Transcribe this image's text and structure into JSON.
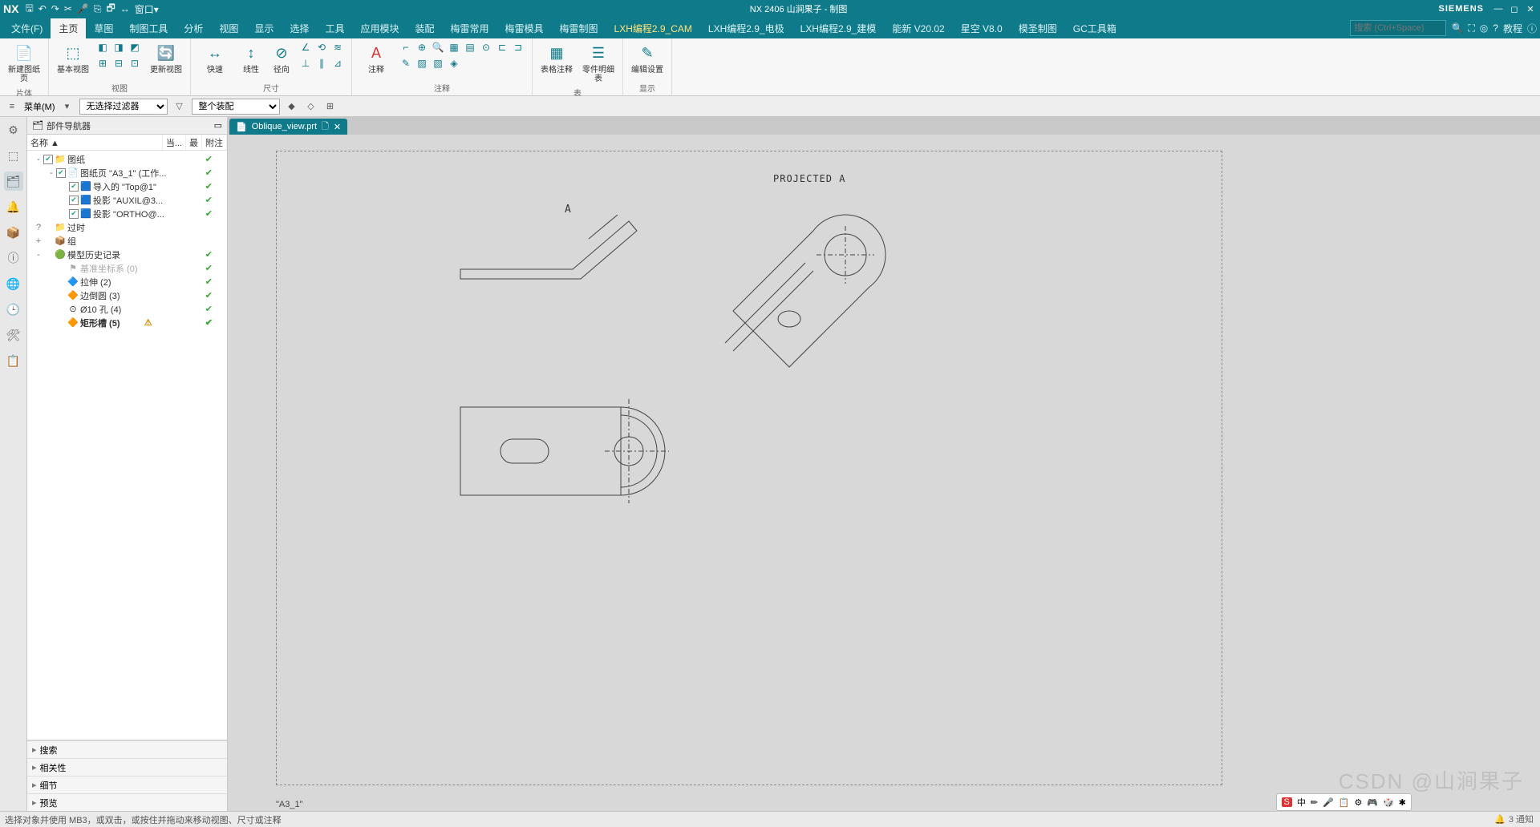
{
  "title": "NX 2406 山涧果子 - 制图",
  "brand": "SIEMENS",
  "qat": [
    "🖫",
    "↶",
    "↷",
    "✂",
    "🎤",
    "⎘",
    "🗗",
    "↔",
    "窗口▾"
  ],
  "menu": [
    {
      "label": "文件(F)",
      "active": false
    },
    {
      "label": "主页",
      "active": true
    },
    {
      "label": "草图",
      "active": false
    },
    {
      "label": "制图工具",
      "active": false
    },
    {
      "label": "分析",
      "active": false
    },
    {
      "label": "视图",
      "active": false
    },
    {
      "label": "显示",
      "active": false
    },
    {
      "label": "选择",
      "active": false
    },
    {
      "label": "工具",
      "active": false
    },
    {
      "label": "应用模块",
      "active": false
    },
    {
      "label": "装配",
      "active": false
    },
    {
      "label": "梅雷常用",
      "active": false
    },
    {
      "label": "梅雷模具",
      "active": false
    },
    {
      "label": "梅雷制图",
      "active": false
    },
    {
      "label": "LXH编程2.9_CAM",
      "active": false,
      "hl": true
    },
    {
      "label": "LXH编程2.9_电极",
      "active": false
    },
    {
      "label": "LXH编程2.9_建模",
      "active": false
    },
    {
      "label": "能新 V20.02",
      "active": false
    },
    {
      "label": "星空 V8.0",
      "active": false
    },
    {
      "label": "模圣制图",
      "active": false
    },
    {
      "label": "GC工具箱",
      "active": false
    }
  ],
  "search_placeholder": "搜索 (Ctrl+Space)",
  "tutorial": "教程",
  "ribbon": {
    "g1": {
      "label": "片体",
      "btn1": "新建图纸页"
    },
    "g2": {
      "label": "视图",
      "btn1": "基本视图",
      "btn2": "更新视图"
    },
    "g3": {
      "label": "尺寸",
      "btn1": "快速",
      "btn2": "线性",
      "btn3": "径向"
    },
    "g4": {
      "label": "注释",
      "btn1": "注释"
    },
    "g5": {
      "label": "表",
      "btn1": "表格注释",
      "btn2": "零件明细表"
    },
    "g6": {
      "label": "显示",
      "btn1": "编辑设置"
    }
  },
  "filter": {
    "menu": "菜单(M)",
    "sel1": "无选择过滤器",
    "sel2": "整个装配"
  },
  "nav": {
    "title": "部件导航器",
    "cols": {
      "c1": "名称 ▲",
      "c2": "当...",
      "c3": "最",
      "c4": "附注"
    },
    "tree": [
      {
        "d": 0,
        "tw": "-",
        "ck": true,
        "ic": "📁",
        "txt": "图纸",
        "chk": true
      },
      {
        "d": 1,
        "tw": "-",
        "ck": true,
        "ic": "📄",
        "txt": "图纸页 \"A3_1\" (工作...",
        "chk": true
      },
      {
        "d": 2,
        "tw": "",
        "ck": true,
        "ic": "🟦",
        "txt": "导入的 \"Top@1\"",
        "chk": true
      },
      {
        "d": 2,
        "tw": "",
        "ck": true,
        "ic": "🟦",
        "txt": "投影 \"AUXIL@3...",
        "chk": true
      },
      {
        "d": 2,
        "tw": "",
        "ck": true,
        "ic": "🟦",
        "txt": "投影 \"ORTHO@...",
        "chk": true
      },
      {
        "d": 0,
        "tw": "?",
        "ck": false,
        "ic": "📁",
        "txt": "过时",
        "chk": false
      },
      {
        "d": 0,
        "tw": "+",
        "ck": false,
        "ic": "📦",
        "txt": "组",
        "chk": false
      },
      {
        "d": 0,
        "tw": "-",
        "ck": false,
        "ic": "🟢",
        "txt": "模型历史记录",
        "chk": true,
        "bold": false
      },
      {
        "d": 1,
        "tw": "",
        "ck": false,
        "ic": "⚑",
        "txt": "基准坐标系 (0)",
        "chk": true,
        "dim": true
      },
      {
        "d": 1,
        "tw": "",
        "ck": false,
        "ic": "🔷",
        "txt": "拉伸 (2)",
        "chk": true
      },
      {
        "d": 1,
        "tw": "",
        "ck": false,
        "ic": "🔶",
        "txt": "边倒圆 (3)",
        "chk": true
      },
      {
        "d": 1,
        "tw": "",
        "ck": false,
        "ic": "⊙",
        "txt": "Ø10 孔 (4)",
        "chk": true
      },
      {
        "d": 1,
        "tw": "",
        "ck": false,
        "ic": "🔶",
        "txt": "矩形槽 (5)",
        "chk": true,
        "bold": true,
        "warn": true
      }
    ],
    "acc": [
      "搜索",
      "相关性",
      "细节",
      "预览"
    ]
  },
  "tab": {
    "name": "Oblique_view.prt",
    "icon": "📄"
  },
  "canvas": {
    "sheet": "\"A3_1\"",
    "proj": "PROJECTED  A",
    "a": "A"
  },
  "status": "选择对象并使用 MB3，或双击，或按住并拖动来移动视图、尺寸或注释",
  "ime": [
    "S",
    "中",
    "✏",
    "🎤",
    "📋",
    "⚙",
    "🎮",
    "🎲",
    "✱"
  ],
  "watermark": "CSDN @山涧果子",
  "notif": "3 通知"
}
